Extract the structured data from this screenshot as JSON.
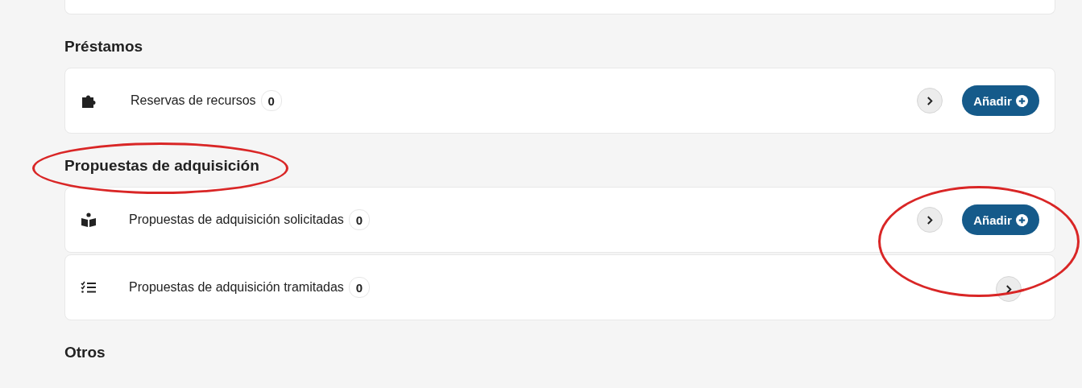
{
  "sections": [
    {
      "kind": "cut"
    },
    {
      "kind": "group",
      "title": "Préstamos",
      "items": [
        {
          "label": "Reservas de recursos",
          "count": "0",
          "add_button": "Añadir"
        }
      ]
    },
    {
      "kind": "group",
      "title": "Propuestas de adquisición",
      "items": [
        {
          "label": "Propuestas de adquisición solicitadas",
          "count": "0",
          "add_button": "Añadir"
        },
        {
          "label": "Propuestas de adquisición tramitadas",
          "count": "0"
        }
      ]
    },
    {
      "kind": "heading",
      "title": "Otros"
    }
  ],
  "annotations": [
    {
      "kind": "ellipse"
    },
    {
      "kind": "ellipse"
    }
  ]
}
